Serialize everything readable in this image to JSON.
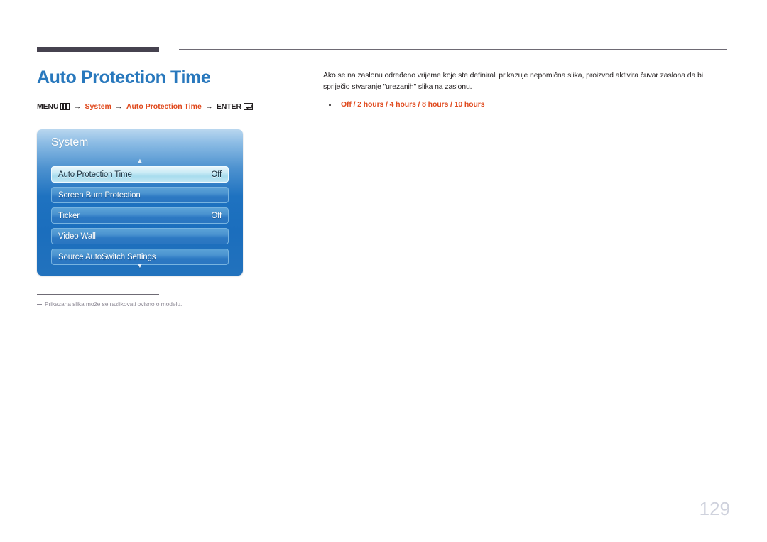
{
  "header": {
    "rule_color": "#46424f"
  },
  "page_title": "Auto Protection Time",
  "breadcrumb": {
    "menu_label": "MENU",
    "menu_icon": "menu-bars-icon",
    "arrow": "→",
    "step1": "System",
    "step2": "Auto Protection Time",
    "enter_label": "ENTER",
    "enter_icon": "enter-return-icon"
  },
  "osd": {
    "title": "System",
    "scroll_up_icon": "▲",
    "scroll_down_icon": "▼",
    "rows": [
      {
        "label": "Auto Protection Time",
        "value": "Off",
        "selected": true
      },
      {
        "label": "Screen Burn Protection",
        "value": "",
        "selected": false
      },
      {
        "label": "Ticker",
        "value": "Off",
        "selected": false
      },
      {
        "label": "Video Wall",
        "value": "",
        "selected": false
      },
      {
        "label": "Source AutoSwitch Settings",
        "value": "",
        "selected": false
      }
    ]
  },
  "footnote": "Prikazana slika može se razlikovati ovisno o modelu.",
  "description": "Ako se na zaslonu određeno vrijeme koje ste definirali prikazuje nepomična slika, proizvod aktivira čuvar zaslona da bi spriječio stvaranje \"urezanih\" slika na zaslonu.",
  "options": {
    "items": [
      "Off",
      "2 hours",
      "4 hours",
      "8 hours",
      "10 hours"
    ],
    "separator": " / ",
    "text": "Off / 2 hours / 4 hours / 8 hours / 10 hours"
  },
  "page_number": "129",
  "colors": {
    "title_blue": "#2878bd",
    "accent_orange": "#e0491d",
    "body_text": "#231f20",
    "footnote_gray": "#8e8a96",
    "page_number_gray": "#cfd2dd"
  }
}
